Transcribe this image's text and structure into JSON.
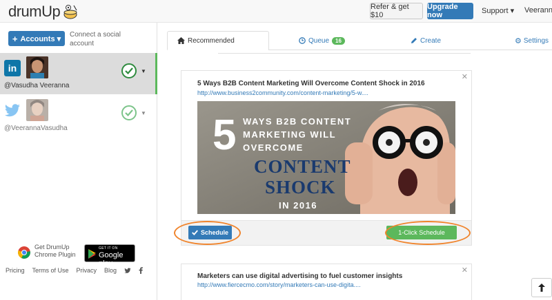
{
  "header": {
    "logo_text": "drumUp",
    "refer_label": "Refer & get $10",
    "upgrade_label": "Upgrade now",
    "support_label": "Support ▾",
    "user_label": "Veeranna"
  },
  "sidebar": {
    "accounts_label": "Accounts ▾",
    "connect_text": "Connect a social account",
    "accounts": [
      {
        "network": "linkedin",
        "name": "@Vasudha Veeranna",
        "active": true
      },
      {
        "network": "twitter",
        "name": "@VeerannaVasudha",
        "active": false
      }
    ],
    "chrome_plugin": "Get DrumUp Chrome Plugin",
    "gplay_top": "GET IT ON",
    "gplay_main": "Google play",
    "footer_links": [
      "Pricing",
      "Terms of Use",
      "Privacy",
      "Blog"
    ]
  },
  "tabs": {
    "recommended": "Recommended",
    "queue": "Queue",
    "queue_count": "16",
    "create": "Create",
    "settings": "Settings"
  },
  "cards": [
    {
      "title": "5 Ways B2B Content Marketing Will Overcome Content Shock in 2016",
      "link": "http://www.business2community.com/content-marketing/5-w....",
      "image_text": {
        "number": "5",
        "line1": "WAYS B2B CONTENT",
        "line2": "MARKETING WILL",
        "line3": "OVERCOME",
        "big1": "CONTENT",
        "big2": "SHOCK",
        "year": "IN 2016"
      },
      "schedule_label": "Schedule",
      "oneclick_label": "1-Click Schedule"
    },
    {
      "title": "Marketers can use digital advertising to fuel customer insights",
      "link": "http://www.fiercecmo.com/story/marketers-can-use-digita...."
    }
  ],
  "colors": {
    "primary": "#337ab7",
    "success": "#5cb85c",
    "highlight": "#f0842c",
    "linkedin": "#0e76a8",
    "twitter": "#55acee"
  }
}
